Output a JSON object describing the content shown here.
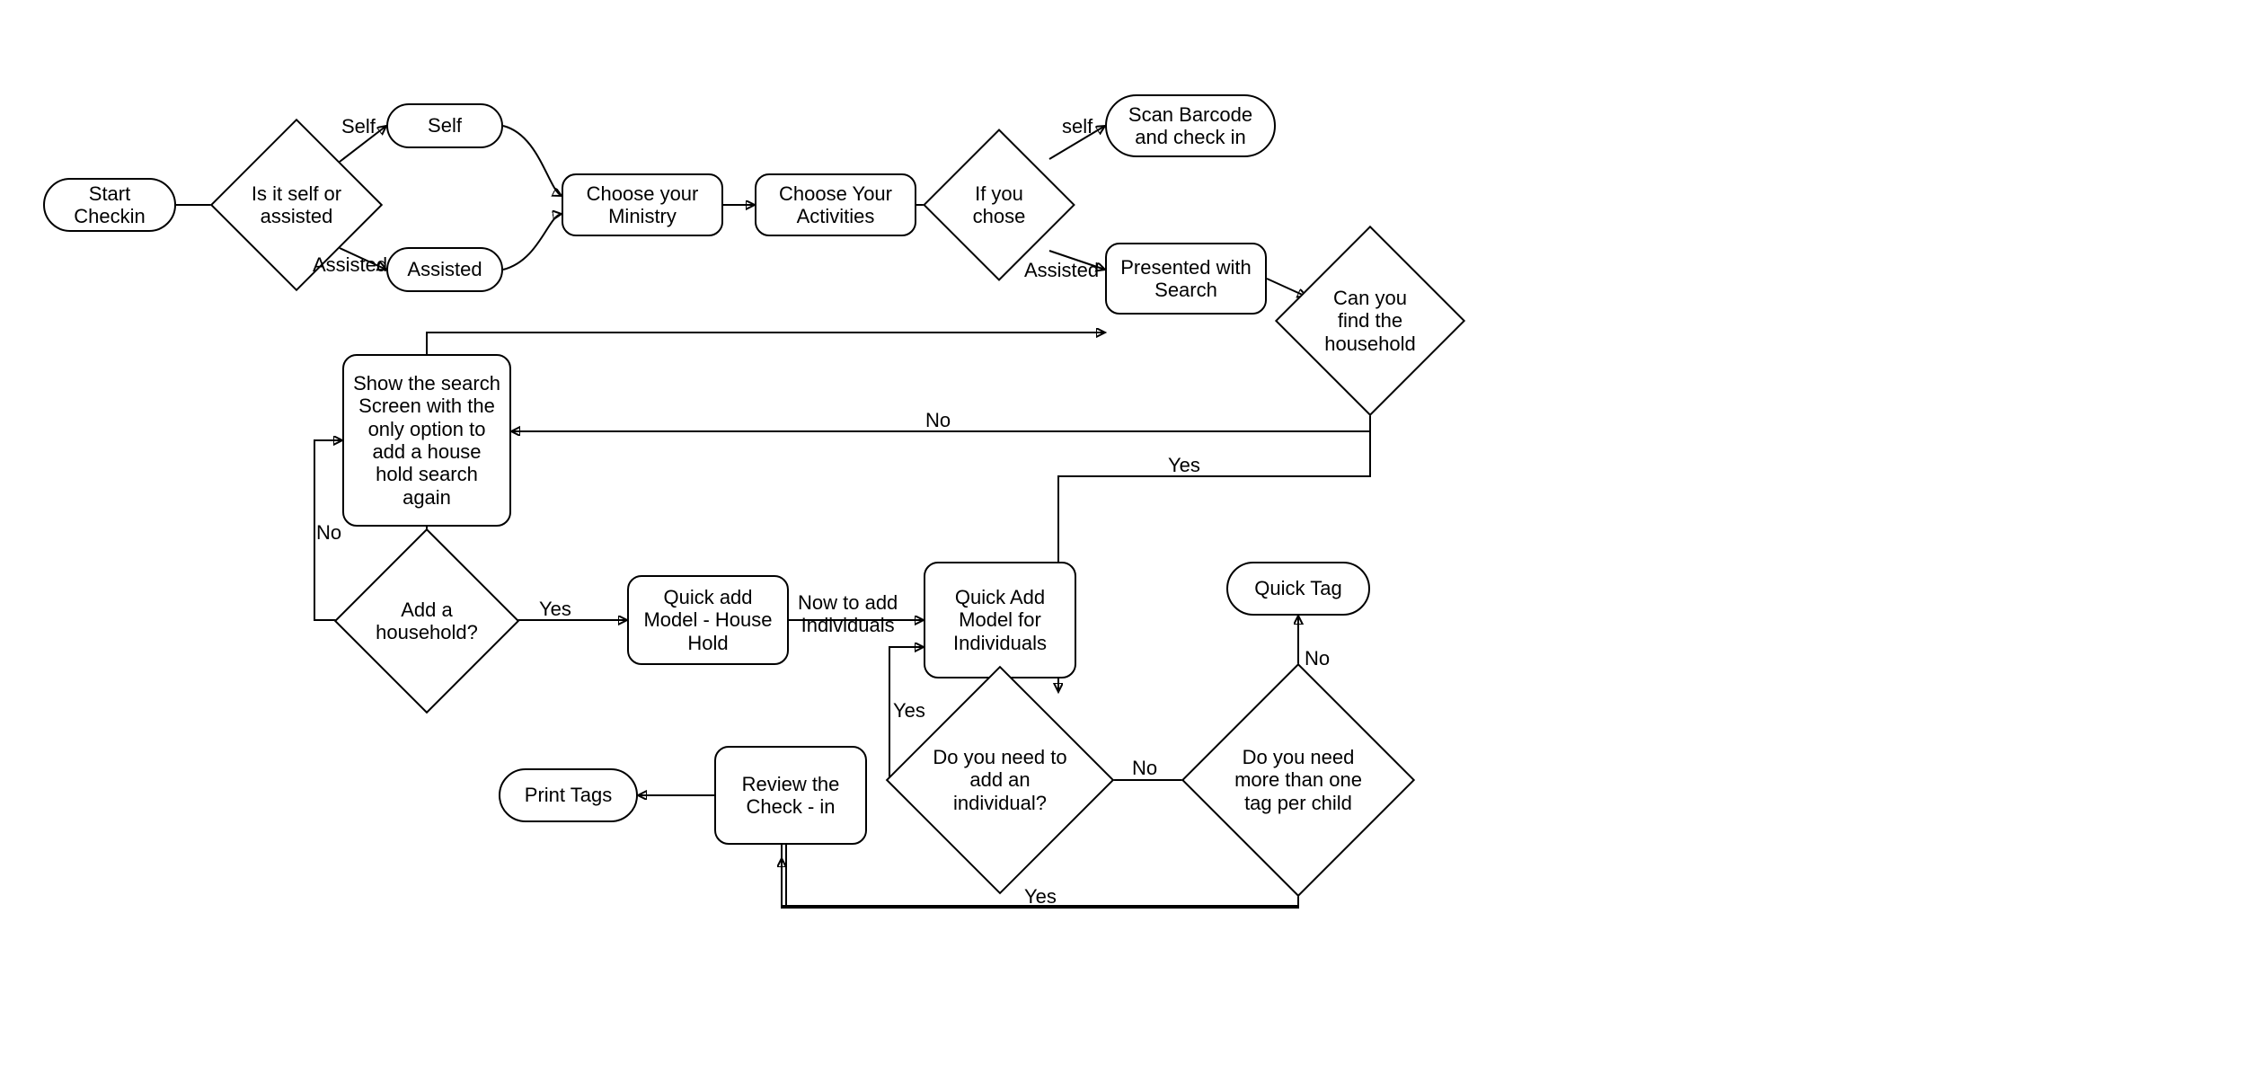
{
  "diagram": {
    "type": "flowchart",
    "nodes": {
      "start": {
        "shape": "terminator",
        "label": "Start Checkin"
      },
      "self_or_assisted": {
        "shape": "decision",
        "label": "Is it self or assisted"
      },
      "self": {
        "shape": "terminator",
        "label": "Self"
      },
      "assisted": {
        "shape": "terminator",
        "label": "Assisted"
      },
      "choose_ministry": {
        "shape": "process",
        "label": "Choose your Ministry"
      },
      "choose_activities": {
        "shape": "process",
        "label": "Choose Your Activities"
      },
      "if_you_chose": {
        "shape": "decision",
        "label": "If you chose"
      },
      "scan_barcode": {
        "shape": "terminator",
        "label": "Scan Barcode and check in"
      },
      "presented_search": {
        "shape": "process",
        "label": "Presented with Search"
      },
      "can_find_household": {
        "shape": "decision",
        "label": "Can you find the household"
      },
      "show_search_screen": {
        "shape": "process",
        "label": "Show the search Screen with the only option to add a house hold search again"
      },
      "add_household": {
        "shape": "decision",
        "label": "Add a household?"
      },
      "quick_add_household": {
        "shape": "process",
        "label": "Quick add Model - House Hold"
      },
      "quick_add_individuals": {
        "shape": "process",
        "label": "Quick Add Model for Individuals"
      },
      "need_add_individual": {
        "shape": "decision",
        "label": "Do you need to add an individual?"
      },
      "need_more_tags": {
        "shape": "decision",
        "label": "Do you need more than one tag per child"
      },
      "quick_tag": {
        "shape": "terminator",
        "label": "Quick Tag"
      },
      "review_checkin": {
        "shape": "process",
        "label": "Review the Check - in"
      },
      "print_tags": {
        "shape": "terminator",
        "label": "Print Tags"
      }
    },
    "edges": [
      {
        "from": "start",
        "to": "self_or_assisted",
        "label": ""
      },
      {
        "from": "self_or_assisted",
        "to": "self",
        "label": "Self"
      },
      {
        "from": "self_or_assisted",
        "to": "assisted",
        "label": "Assisted"
      },
      {
        "from": "self",
        "to": "choose_ministry",
        "label": ""
      },
      {
        "from": "assisted",
        "to": "choose_ministry",
        "label": ""
      },
      {
        "from": "choose_ministry",
        "to": "choose_activities",
        "label": ""
      },
      {
        "from": "choose_activities",
        "to": "if_you_chose",
        "label": ""
      },
      {
        "from": "if_you_chose",
        "to": "scan_barcode",
        "label": "self"
      },
      {
        "from": "if_you_chose",
        "to": "presented_search",
        "label": "Assisted"
      },
      {
        "from": "presented_search",
        "to": "can_find_household",
        "label": ""
      },
      {
        "from": "can_find_household",
        "to": "show_search_screen",
        "label": "No"
      },
      {
        "from": "can_find_household",
        "to": "need_add_individual",
        "label": "Yes"
      },
      {
        "from": "show_search_screen",
        "to": "presented_search",
        "label": ""
      },
      {
        "from": "show_search_screen",
        "to": "add_household",
        "label": ""
      },
      {
        "from": "add_household",
        "to": "show_search_screen",
        "label": "No"
      },
      {
        "from": "add_household",
        "to": "quick_add_household",
        "label": "Yes"
      },
      {
        "from": "quick_add_household",
        "to": "quick_add_individuals",
        "label": "Now to add Individuals"
      },
      {
        "from": "quick_add_individuals",
        "to": "need_add_individual",
        "label": ""
      },
      {
        "from": "need_add_individual",
        "to": "quick_add_individuals",
        "label": "Yes"
      },
      {
        "from": "need_add_individual",
        "to": "need_more_tags",
        "label": "No"
      },
      {
        "from": "need_more_tags",
        "to": "quick_tag",
        "label": "No"
      },
      {
        "from": "need_more_tags",
        "to": "review_checkin",
        "label": "Yes"
      },
      {
        "from": "review_checkin",
        "to": "print_tags",
        "label": ""
      }
    ]
  },
  "edge_labels": {
    "self": "Self",
    "assisted": "Assisted",
    "self2": "self",
    "assisted2": "Assisted",
    "no1": "No",
    "yes1": "Yes",
    "no2": "No",
    "yes2": "Yes",
    "now_add": "Now to add\nIndividuals",
    "yes3": "Yes",
    "no3": "No",
    "no4": "No",
    "yes4": "Yes"
  }
}
